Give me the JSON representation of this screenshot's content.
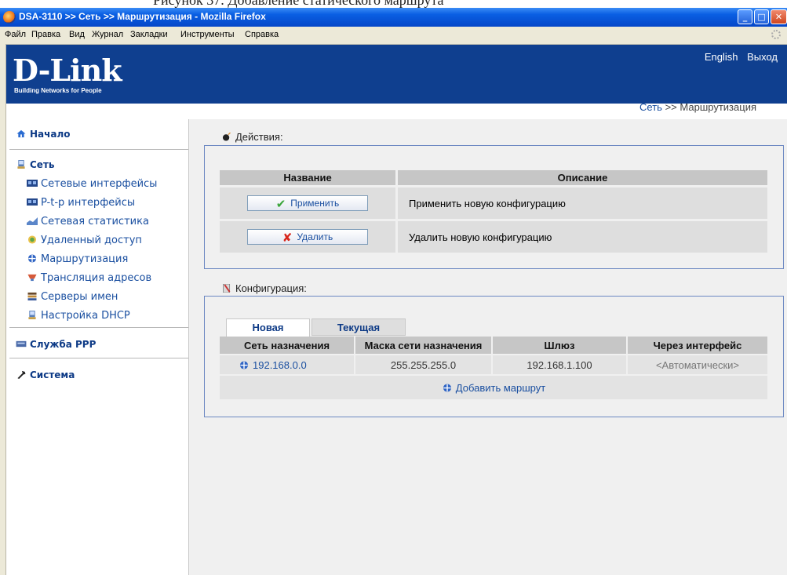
{
  "caption": "Рисунок 37. Добавление статического маршрута",
  "window": {
    "title": "DSA-3110 >> Сеть >> Маршрутизация - Mozilla Firefox"
  },
  "menu": [
    "Файл",
    "Правка",
    "Вид",
    "Журнал",
    "Закладки",
    "Инструменты",
    "Справка"
  ],
  "header": {
    "logo": "D-Link",
    "tagline": "Building Networks for People",
    "english": "English",
    "logout": "Выход",
    "brand_color": "#0f3f8f"
  },
  "breadcrumb": {
    "section": "Сеть",
    "separator": ">>",
    "page": "Маршрутизация"
  },
  "sidebar": {
    "home": "Начало",
    "network": "Сеть",
    "items": [
      {
        "label": "Сетевые интерфейсы",
        "icon": "network-card-icon"
      },
      {
        "label": "P-t-p интерфейсы",
        "icon": "ptp-interface-icon"
      },
      {
        "label": "Сетевая статистика",
        "icon": "statistics-icon"
      },
      {
        "label": "Удаленный доступ",
        "icon": "remote-access-icon"
      },
      {
        "label": "Маршрутизация",
        "icon": "routing-icon"
      },
      {
        "label": "Трансляция адресов",
        "icon": "nat-icon"
      },
      {
        "label": "Серверы имен",
        "icon": "dns-icon"
      },
      {
        "label": "Настройка DHCP",
        "icon": "dhcp-icon"
      }
    ],
    "ppp": "Служба PPP",
    "system": "Система"
  },
  "actions": {
    "legend": "Действия:",
    "col_name": "Название",
    "col_desc": "Описание",
    "rows": [
      {
        "button": "Применить",
        "desc": "Применить новую конфигурацию"
      },
      {
        "button": "Удалить",
        "desc": "Удалить новую конфигурацию"
      }
    ]
  },
  "config": {
    "legend": "Конфигурация:",
    "tabs": [
      "Новая",
      "Текущая"
    ],
    "columns": [
      "Сеть назначения",
      "Маска сети назначения",
      "Шлюз",
      "Через интерфейс"
    ],
    "rows": [
      {
        "dest": "192.168.0.0",
        "mask": "255.255.255.0",
        "gateway": "192.168.1.100",
        "iface": "<Автоматически>"
      }
    ],
    "add_route": "Добавить маршрут"
  }
}
